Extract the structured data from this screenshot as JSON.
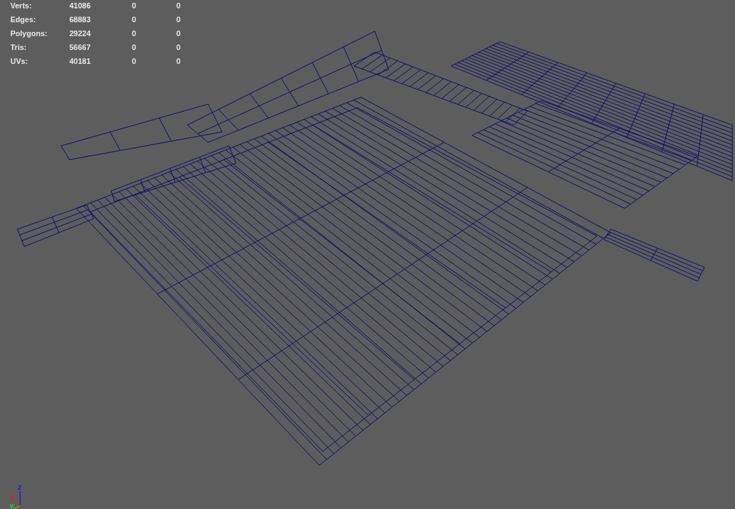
{
  "stats": [
    {
      "label": "Verts:",
      "values": [
        "41086",
        "0",
        "0"
      ]
    },
    {
      "label": "Edges:",
      "values": [
        "68883",
        "0",
        "0"
      ]
    },
    {
      "label": "Polygons:",
      "values": [
        "29224",
        "0",
        "0"
      ]
    },
    {
      "label": "Tris:",
      "values": [
        "56667",
        "0",
        "0"
      ]
    },
    {
      "label": "UVs:",
      "values": [
        "40181",
        "0",
        "0"
      ]
    }
  ],
  "axis_labels": {
    "x": "x",
    "y": "y",
    "z": "z"
  }
}
